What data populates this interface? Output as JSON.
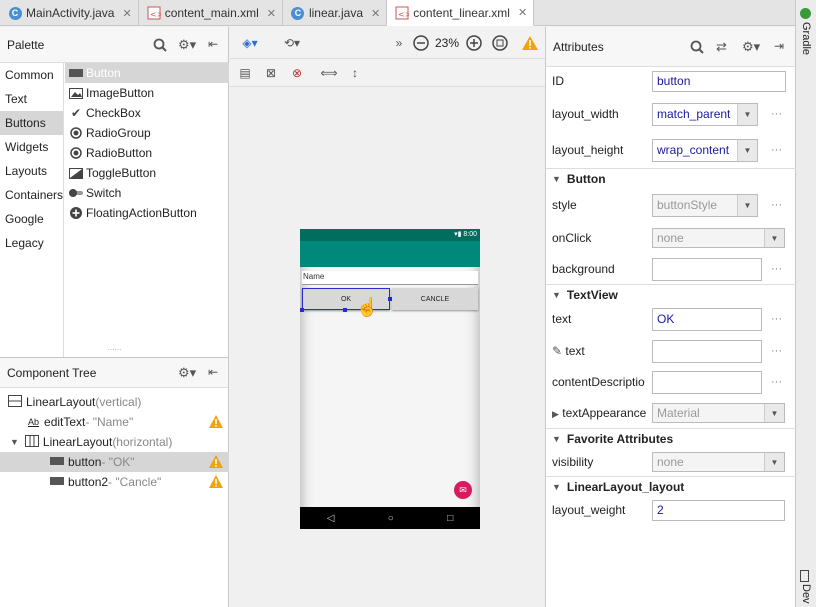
{
  "tabs": [
    {
      "label": "MainActivity.java",
      "icon": "java-class-icon",
      "active": false
    },
    {
      "label": "content_main.xml",
      "icon": "xml-layout-icon",
      "active": false
    },
    {
      "label": "linear.java",
      "icon": "java-class-icon",
      "active": false
    },
    {
      "label": "content_linear.xml",
      "icon": "xml-layout-icon",
      "active": true
    }
  ],
  "right_strip": {
    "gradle_label": "Gradle",
    "device_label": "Dev"
  },
  "palette": {
    "title": "Palette",
    "categories": [
      "Common",
      "Text",
      "Buttons",
      "Widgets",
      "Layouts",
      "Containers",
      "Google",
      "Legacy"
    ],
    "selected_category": "Buttons",
    "items": [
      "Button",
      "ImageButton",
      "CheckBox",
      "RadioGroup",
      "RadioButton",
      "ToggleButton",
      "Switch",
      "FloatingActionButton"
    ]
  },
  "component_tree": {
    "title": "Component Tree",
    "nodes": [
      {
        "name": "LinearLayout",
        "detail": "(vertical)"
      },
      {
        "name": "editText",
        "detail": "- \"Name\""
      },
      {
        "name": "LinearLayout",
        "detail": "(horizontal)"
      },
      {
        "name": "button",
        "detail": "- \"OK\""
      },
      {
        "name": "button2",
        "detail": "- \"Cancle\""
      }
    ]
  },
  "canvas": {
    "zoom": "23%",
    "phone": {
      "status_time": "8:00",
      "name_hint": "Name",
      "ok_label": "OK",
      "cancel_label": "CANCLE"
    }
  },
  "attributes": {
    "title": "Attributes",
    "id_label": "ID",
    "id_value": "button",
    "layout_width_label": "layout_width",
    "layout_width_value": "match_parent",
    "layout_height_label": "layout_height",
    "layout_height_value": "wrap_content",
    "section_button": "Button",
    "style_label": "style",
    "style_value": "buttonStyle",
    "onclick_label": "onClick",
    "onclick_value": "none",
    "background_label": "background",
    "section_textview": "TextView",
    "text_label": "text",
    "text_value": "OK",
    "text_tools_label": "text",
    "content_desc_label": "contentDescriptio",
    "text_appearance_label": "textAppearance",
    "text_appearance_value": "Material",
    "section_favorite": "Favorite Attributes",
    "visibility_label": "visibility",
    "visibility_value": "none",
    "section_linear": "LinearLayout_layout",
    "layout_weight_label": "layout_weight",
    "layout_weight_value": "2"
  },
  "colors": {
    "accent": "#00897b",
    "statusbar": "#006d5f",
    "fab": "#d81b60",
    "selection": "#2a2ad0",
    "warning": "#f0a30a"
  }
}
